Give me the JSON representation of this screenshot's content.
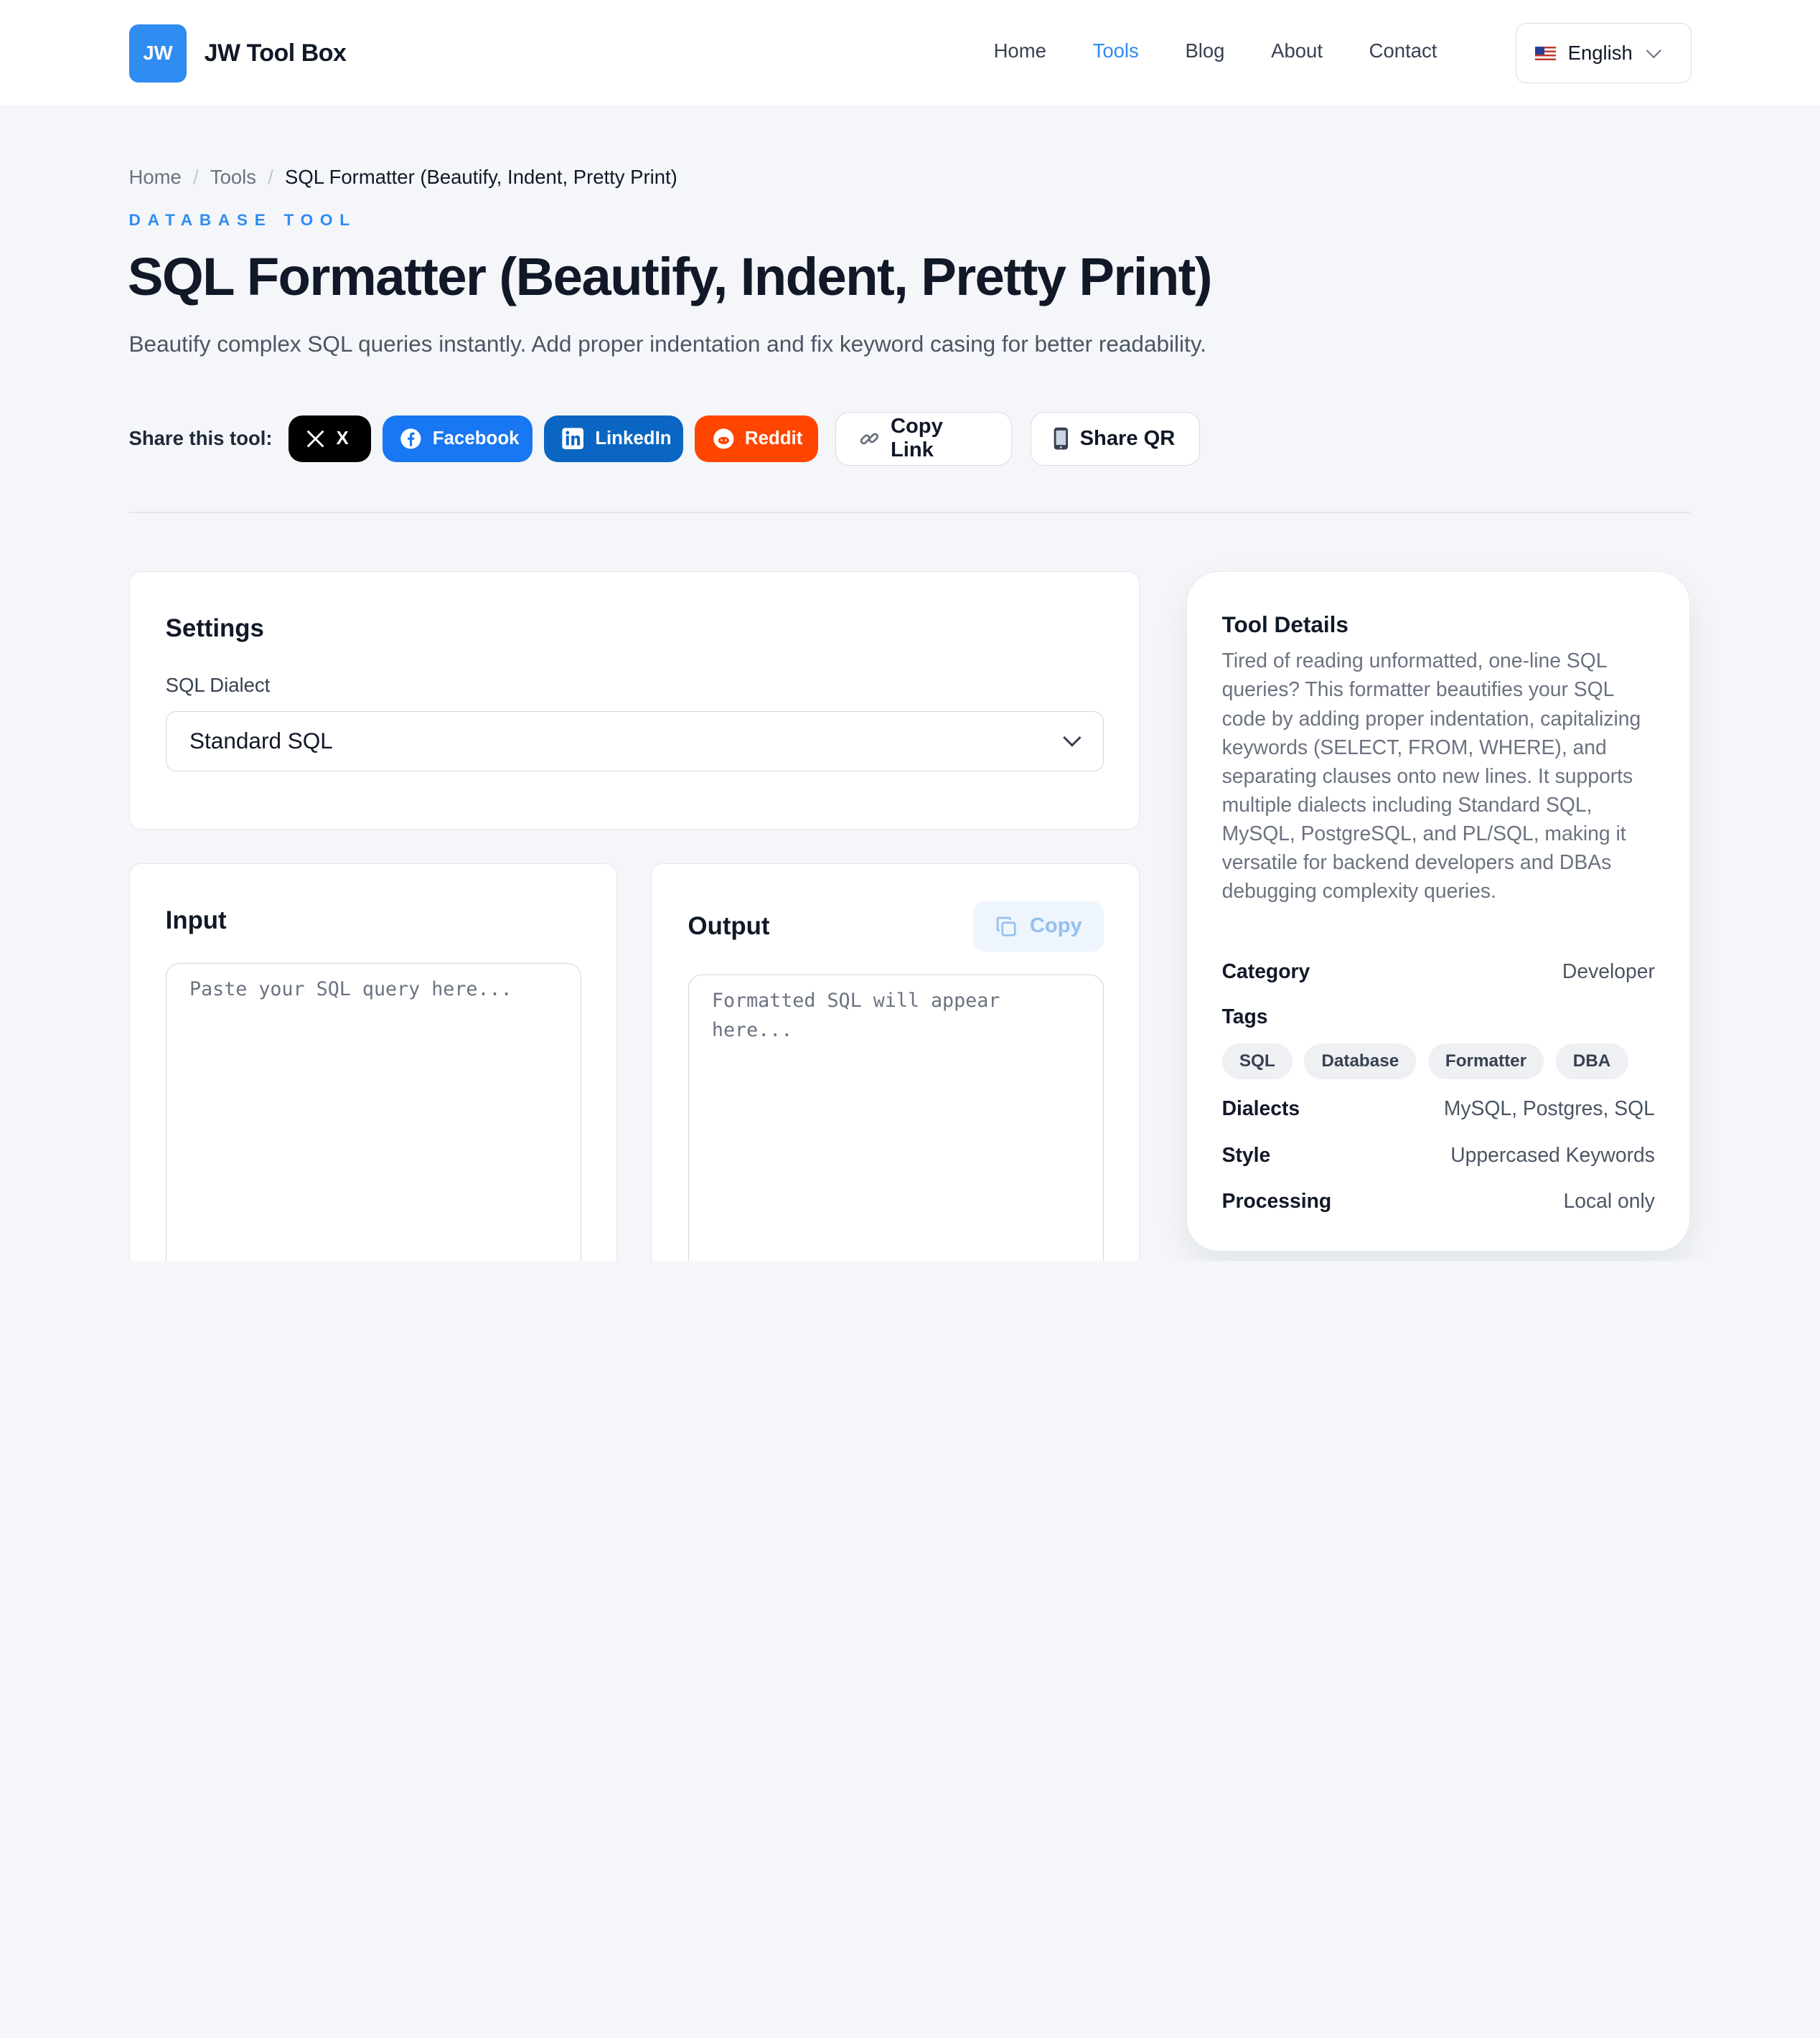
{
  "brand": {
    "badge": "JW",
    "name": "JW Tool Box"
  },
  "nav": {
    "items": [
      "Home",
      "Tools",
      "Blog",
      "About",
      "Contact"
    ],
    "active": "Tools"
  },
  "language": {
    "selected": "English",
    "flag_icon": "us-flag-icon"
  },
  "breadcrumb": {
    "items": [
      "Home",
      "Tools"
    ],
    "separator": "/",
    "current": "SQL Formatter (Beautify, Indent, Pretty Print)"
  },
  "hero": {
    "eyebrow": "DATABASE TOOL",
    "title": "SQL Formatter (Beautify, Indent, Pretty Print)",
    "subtitle": "Beautify complex SQL queries instantly. Add proper indentation and fix keyword casing for better readability."
  },
  "share": {
    "label": "Share this tool:",
    "buttons": {
      "x": "X",
      "facebook": "Facebook",
      "linkedin": "LinkedIn",
      "reddit": "Reddit",
      "copy_link": "Copy Link",
      "share_qr": "Share QR"
    },
    "colors": {
      "x": "#000000",
      "facebook": "#1877f2",
      "linkedin": "#0a66c2",
      "reddit": "#ff4500"
    }
  },
  "settings": {
    "title": "Settings",
    "dialect_label": "SQL Dialect",
    "dialect_value": "Standard SQL"
  },
  "input": {
    "title": "Input",
    "placeholder": "Paste your SQL query here...",
    "value": ""
  },
  "output": {
    "title": "Output",
    "copy_label": "Copy",
    "placeholder": "Formatted SQL will appear here...",
    "value": ""
  },
  "details": {
    "title": "Tool Details",
    "description": "Tired of reading unformatted, one-line SQL queries? This formatter beautifies your SQL code by adding proper indentation, capitalizing keywords (SELECT, FROM, WHERE), and separating clauses onto new lines. It supports multiple dialects including Standard SQL, MySQL, PostgreSQL, and PL/SQL, making it versatile for backend developers and DBAs debugging complexity queries.",
    "category_label": "Category",
    "category_value": "Developer",
    "tags_label": "Tags",
    "tags": [
      "SQL",
      "Database",
      "Formatter",
      "DBA"
    ],
    "dialects_label": "Dialects",
    "dialects_value": "MySQL, Postgres, SQL",
    "style_label": "Style",
    "style_value": "Uppercased Keywords",
    "processing_label": "Processing",
    "processing_value": "Local only"
  },
  "colors": {
    "accent": "#2f8cf0"
  }
}
